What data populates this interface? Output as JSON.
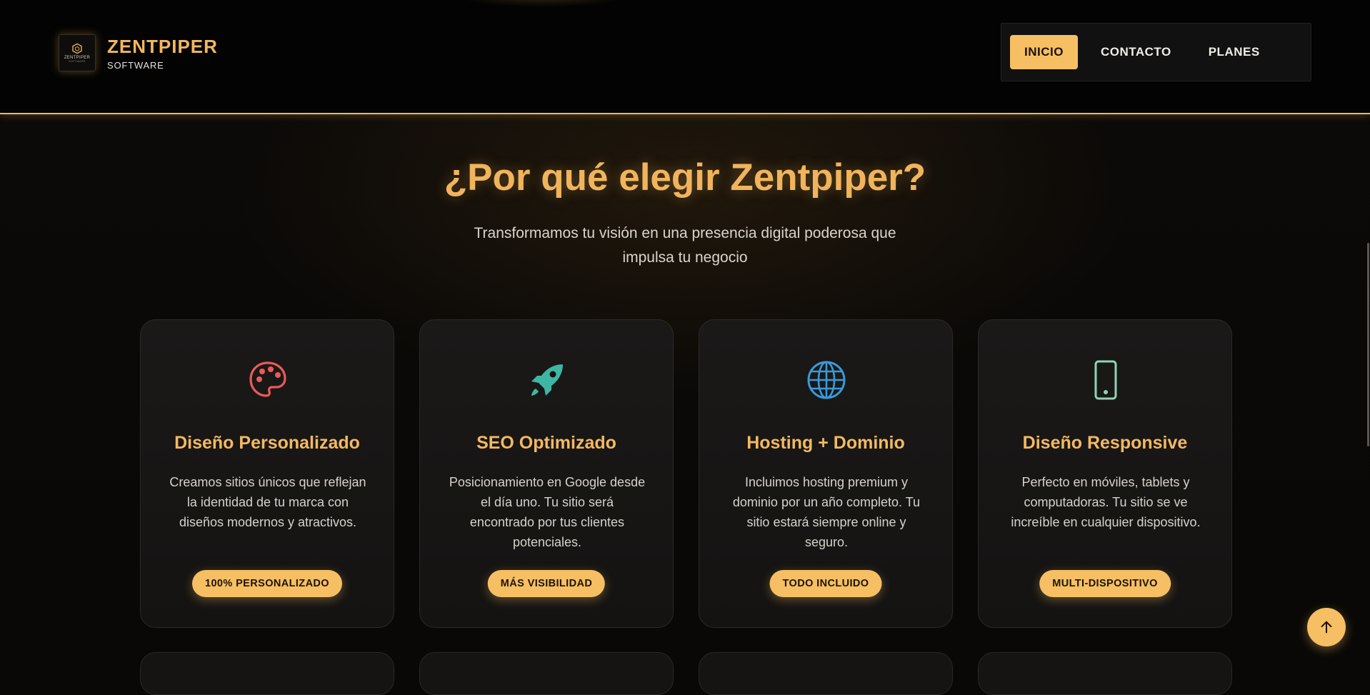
{
  "brand": {
    "name": "ZENTPIPER",
    "tagline": "SOFTWARE",
    "logo_text": "ZENTPIPER",
    "logo_subtext": "SOFTWARE"
  },
  "nav": {
    "items": [
      {
        "label": "INICIO",
        "active": true
      },
      {
        "label": "CONTACTO",
        "active": false
      },
      {
        "label": "PLANES",
        "active": false
      }
    ]
  },
  "hero": {
    "title": "¿Por qué elegir Zentpiper?",
    "subtitle": "Transformamos tu visión en una presencia digital poderosa que impulsa tu negocio"
  },
  "features": [
    {
      "icon": "palette-icon",
      "icon_color": "#e95a5a",
      "title": "Diseño Personalizado",
      "description": "Creamos sitios únicos que reflejan la identidad de tu marca con diseños modernos y atractivos.",
      "badge": "100% PERSONALIZADO"
    },
    {
      "icon": "rocket-icon",
      "icon_color": "#3fb6a2",
      "title": "SEO Optimizado",
      "description": "Posicionamiento en Google desde el día uno. Tu sitio será encontrado por tus clientes potenciales.",
      "badge": "MÁS VISIBILIDAD"
    },
    {
      "icon": "globe-icon",
      "icon_color": "#3a9ad8",
      "title": "Hosting + Dominio",
      "description": "Incluimos hosting premium y dominio por un año completo. Tu sitio estará siempre online y seguro.",
      "badge": "TODO INCLUIDO"
    },
    {
      "icon": "smartphone-icon",
      "icon_color": "#8fd3b3",
      "title": "Diseño Responsive",
      "description": "Perfecto en móviles, tablets y computadoras. Tu sitio se ve increíble en cualquier dispositivo.",
      "badge": "MULTI-DISPOSITIVO"
    }
  ],
  "colors": {
    "accent": "#f7bf63",
    "title": "#f1b45c",
    "background": "#0a0806"
  },
  "back_to_top": {
    "icon": "arrow-up-icon"
  }
}
